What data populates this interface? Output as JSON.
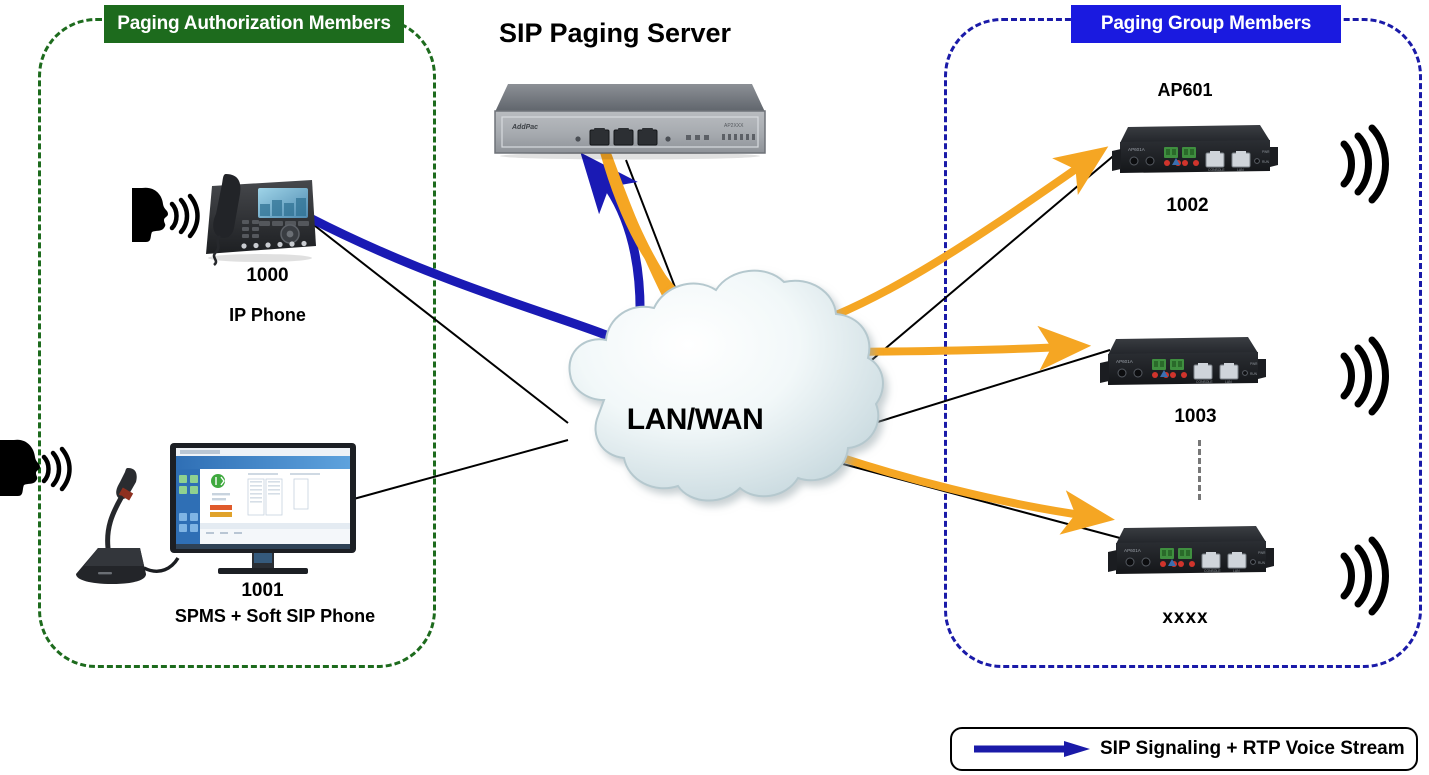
{
  "diagram": {
    "title": "SIP Paging Server",
    "cloud_label": "LAN/WAN"
  },
  "groups": {
    "authorization": {
      "title": "Paging Authorization Members",
      "border_color": "#1d6b1d",
      "title_bg": "#1d6b1d"
    },
    "paging_group": {
      "title": "Paging Group Members",
      "border_color": "#1a1aa8",
      "title_bg": "#1a1ae0"
    }
  },
  "nodes": {
    "ip_phone": {
      "extension": "1000",
      "label": "IP Phone",
      "icon": "desk-ip-phone"
    },
    "soft_phone": {
      "extension": "1001",
      "label": "SPMS +  Soft SIP Phone",
      "icon": "monitor-with-gooseneck-microphone"
    },
    "endpoint_top": {
      "model": "AP601",
      "extension": "1002",
      "icon": "ap601-paging-adapter"
    },
    "endpoint_mid": {
      "extension": "1003",
      "icon": "ap601-paging-adapter"
    },
    "endpoint_bottom": {
      "extension": "xxxx",
      "icon": "ap601-paging-adapter"
    },
    "server": {
      "icon": "rackmount-sip-paging-server",
      "brand": "AddPac"
    }
  },
  "legend": {
    "text": "SIP Signaling + RTP Voice Stream",
    "arrow_color": "#1a1aa8"
  },
  "colors": {
    "signaling_blue": "#1a1ab4",
    "rtp_orange": "#f5a623",
    "link_black": "#000000",
    "cloud_fill": "#e9f2f4"
  }
}
